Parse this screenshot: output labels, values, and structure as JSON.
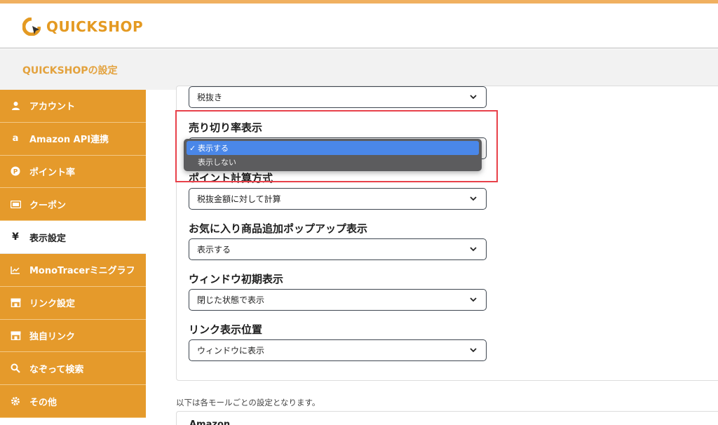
{
  "app": {
    "brand": "QUICKSHOP",
    "brand_color": "#e49a22",
    "settings_title": "QUICKSHOPの設定"
  },
  "sidebar": {
    "accent": "#e59a2b",
    "items": [
      {
        "label": "アカウント",
        "icon": "user-icon",
        "active": false
      },
      {
        "label": "Amazon API連携",
        "icon": "amazon-icon",
        "active": false
      },
      {
        "label": "ポイント率",
        "icon": "point-icon",
        "active": false
      },
      {
        "label": "クーポン",
        "icon": "ticket-icon",
        "active": false
      },
      {
        "label": "表示設定",
        "icon": "yen-icon",
        "active": true
      },
      {
        "label": "MonoTracerミニグラフ",
        "icon": "chart-icon",
        "active": false
      },
      {
        "label": "リンク設定",
        "icon": "store-icon",
        "active": false
      },
      {
        "label": "独自リンク",
        "icon": "store-icon",
        "active": false
      },
      {
        "label": "なぞって検索",
        "icon": "search-icon",
        "active": false
      },
      {
        "label": "その他",
        "icon": "gear-icon",
        "active": false
      }
    ]
  },
  "settings": {
    "tax_select_value": "税抜き",
    "sellout": {
      "label": "売り切り率表示",
      "options": [
        "表示する",
        "表示しない"
      ],
      "selected": "表示する"
    },
    "point_calc": {
      "label": "ポイント計算方式",
      "value": "税抜金額に対して計算"
    },
    "favorite_popup": {
      "label": "お気に入り商品追加ポップアップ表示",
      "value": "表示する"
    },
    "window_initial": {
      "label": "ウィンドウ初期表示",
      "value": "閉じた状態で表示"
    },
    "link_position": {
      "label": "リンク表示位置",
      "value": "ウィンドウに表示"
    }
  },
  "footer": {
    "note": "以下は各モールごとの設定となります。",
    "next_section": "Amazon"
  }
}
